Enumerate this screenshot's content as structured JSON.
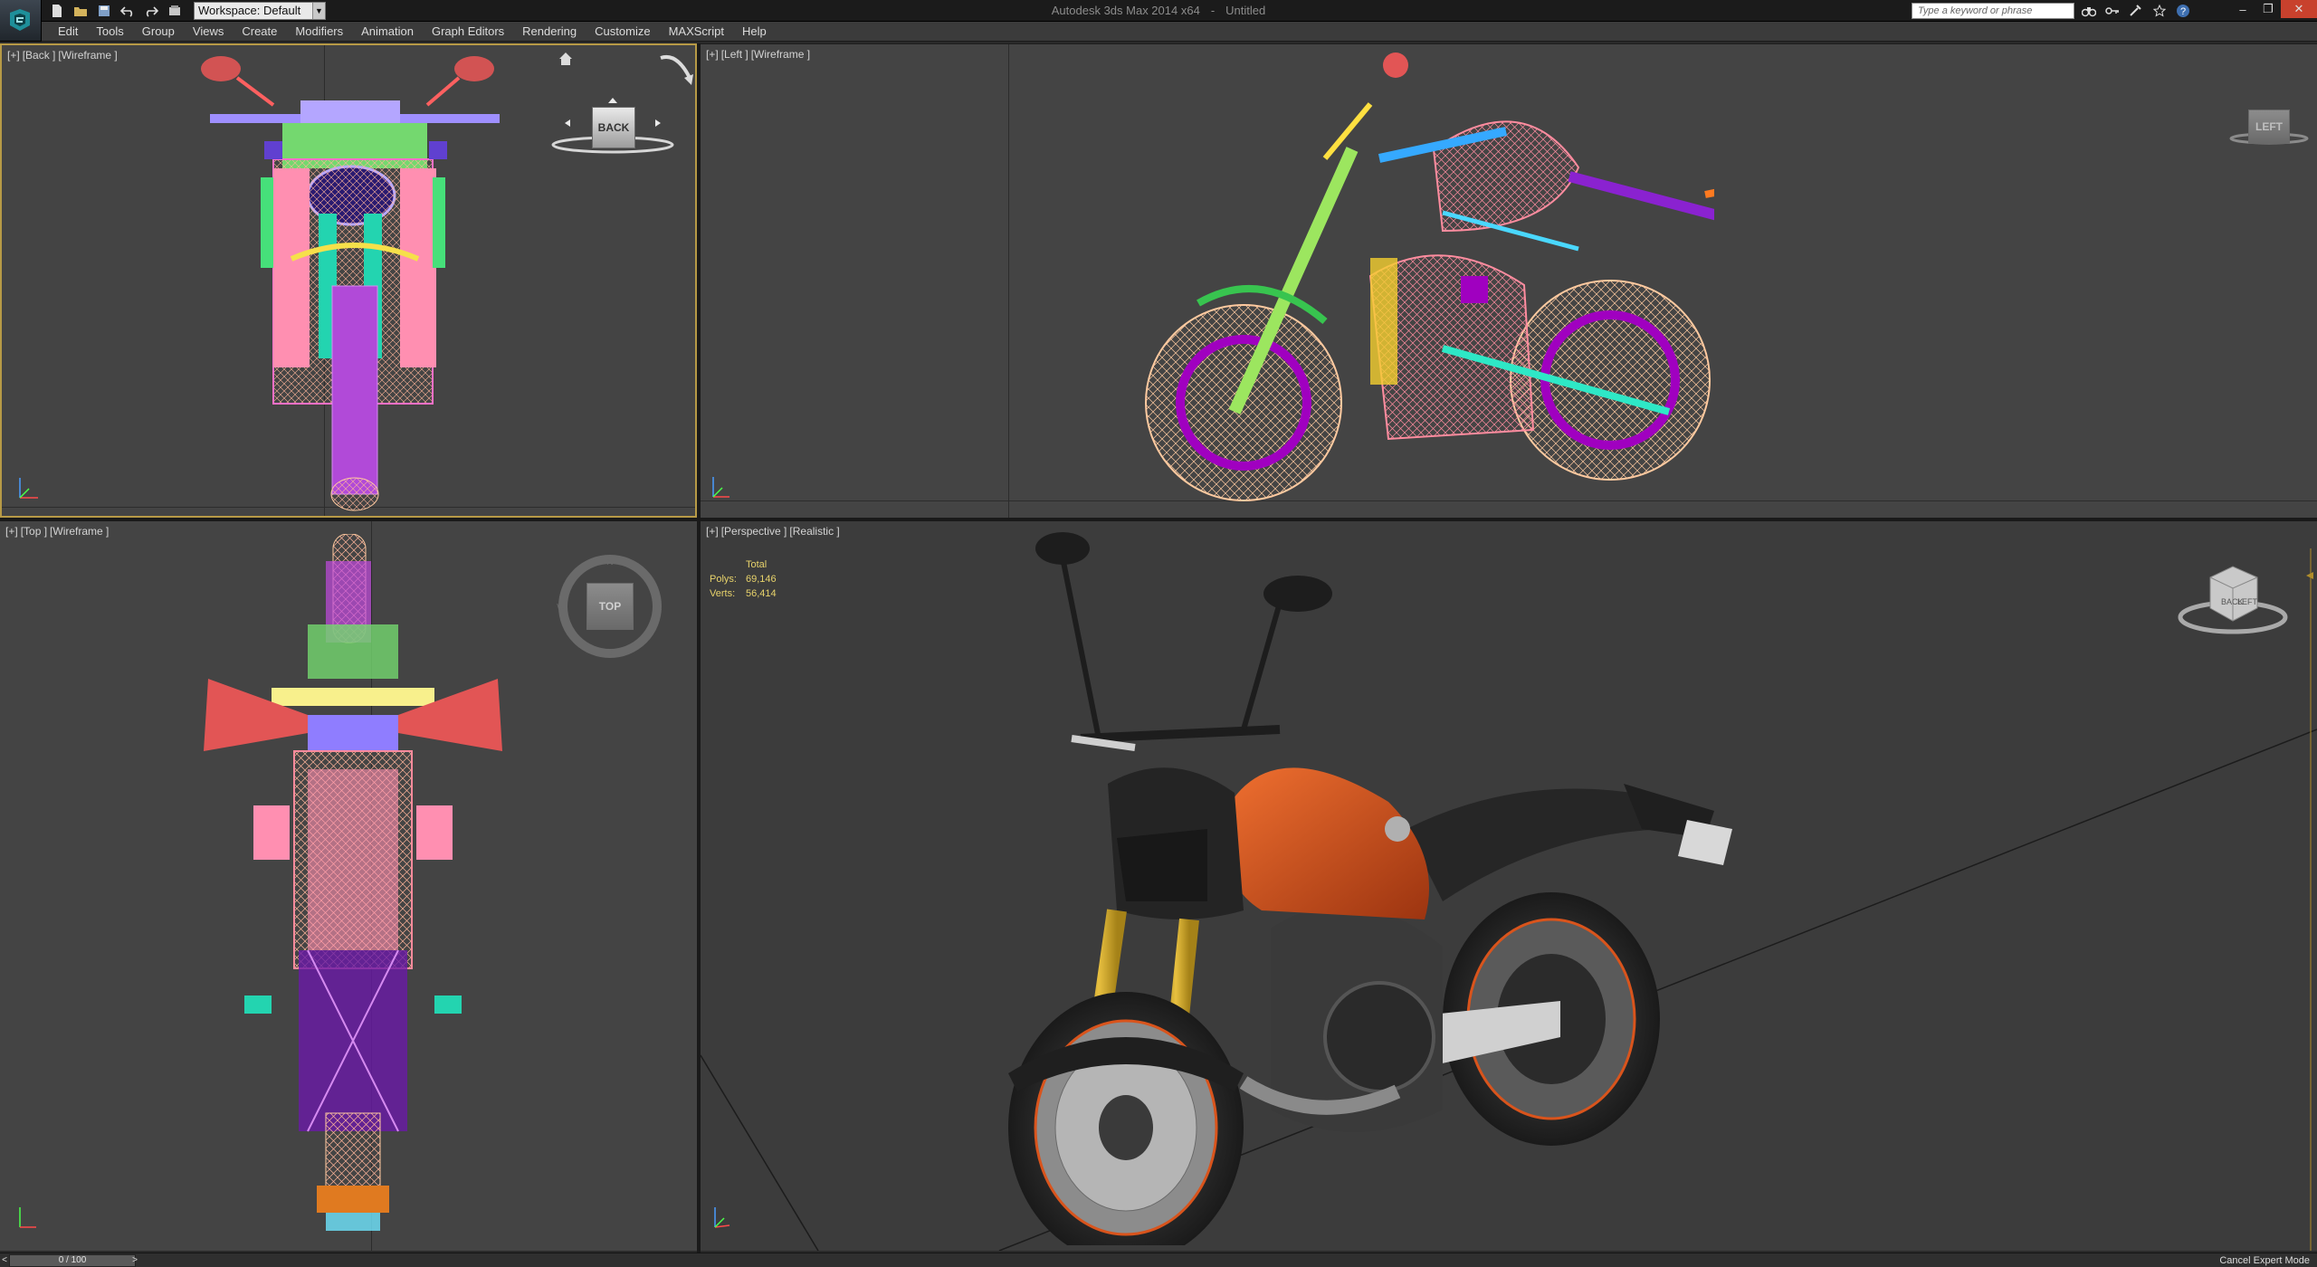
{
  "app": {
    "title": "Autodesk 3ds Max 2014 x64",
    "document": "Untitled",
    "workspace": "Workspace: Default",
    "search_placeholder": "Type a keyword or phrase"
  },
  "menu": [
    "Edit",
    "Tools",
    "Group",
    "Views",
    "Create",
    "Modifiers",
    "Animation",
    "Graph Editors",
    "Rendering",
    "Customize",
    "MAXScript",
    "Help"
  ],
  "viewports": {
    "back": {
      "plus": "[+]",
      "view": "[Back ]",
      "shading": "[Wireframe ]",
      "cube_label": "BACK"
    },
    "left": {
      "plus": "[+]",
      "view": "[Left ]",
      "shading": "[Wireframe ]",
      "cube_label": "LEFT"
    },
    "top": {
      "plus": "[+]",
      "view": "[Top ]",
      "shading": "[Wireframe ]",
      "cube_label": "TOP"
    },
    "perspective": {
      "plus": "[+]",
      "view": "[Perspective ]",
      "shading": "[Realistic ]",
      "stats": {
        "header": "Total",
        "polys_label": "Polys:",
        "polys": "69,146",
        "verts_label": "Verts:",
        "verts": "56,414"
      },
      "cube_back": "BACK",
      "cube_left": "LEFT"
    }
  },
  "status": {
    "time_slider": "0 / 100",
    "prev": "<",
    "next": ">",
    "cancel_expert": "Cancel Expert Mode"
  },
  "icons": [
    "app-logo-icon",
    "new-file-icon",
    "open-file-icon",
    "save-icon",
    "undo-icon",
    "redo-icon",
    "project-folder-icon",
    "binoculars-icon",
    "key-icon",
    "tools-icon",
    "star-icon",
    "help-icon",
    "home-icon",
    "rotate-arrow-icon"
  ],
  "colors": {
    "viewport_bg": "#444444",
    "active_border": "#b79a46",
    "stats_text": "#e8d36b",
    "close_button": "#c8412d",
    "bike_orange": "#d9541c"
  }
}
